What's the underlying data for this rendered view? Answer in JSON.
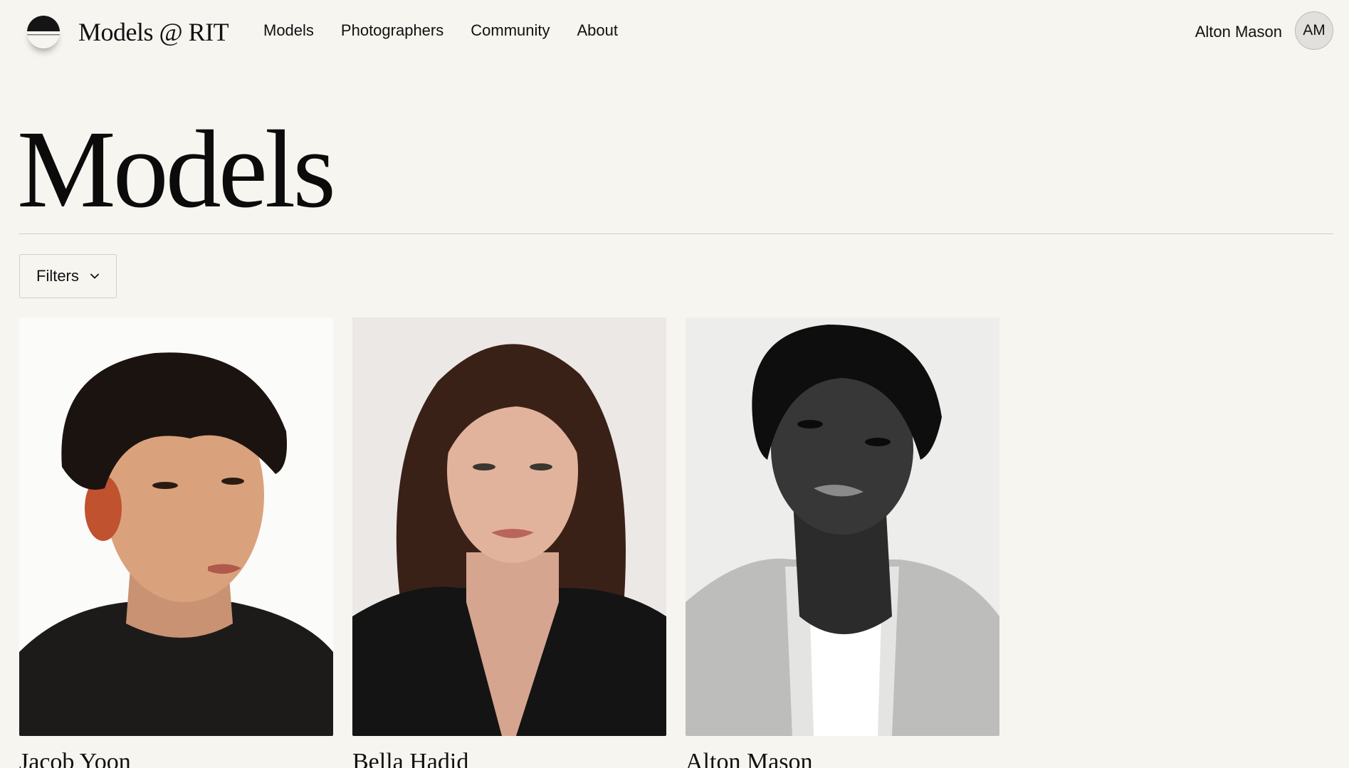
{
  "brand": {
    "logo_icon": "half-moon-logo-icon",
    "name": "Models @ RIT"
  },
  "nav": {
    "items": [
      {
        "label": "Models"
      },
      {
        "label": "Photographers"
      },
      {
        "label": "Community"
      },
      {
        "label": "About"
      }
    ]
  },
  "user": {
    "name": "Alton Mason",
    "initials": "AM"
  },
  "main": {
    "title": "Models",
    "filters_label": "Filters",
    "filters_icon": "chevron-down-icon",
    "models": [
      {
        "name": "Jacob Yoon"
      },
      {
        "name": "Bella Hadid"
      },
      {
        "name": "Alton Mason"
      }
    ]
  },
  "colors": {
    "background": "#f6f5f0",
    "text": "#111111",
    "divider": "#cfcec9"
  }
}
